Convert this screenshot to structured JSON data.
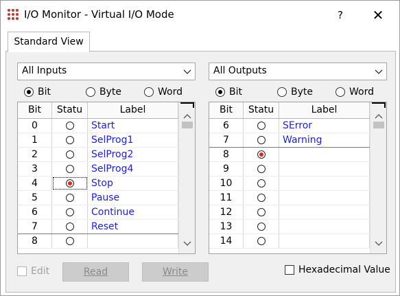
{
  "window": {
    "title": "I/O Monitor - Virtual I/O Mode",
    "help_label": "?",
    "close_label": "✕"
  },
  "tabs": [
    "Standard View"
  ],
  "inputs": {
    "combo_value": "All Inputs",
    "radios": [
      "Bit",
      "Byte",
      "Word"
    ],
    "selected_radio": "Bit",
    "columns": [
      "Bit",
      "Statu",
      "Label"
    ],
    "rows": [
      {
        "bit": "0",
        "on": false,
        "label": "Start"
      },
      {
        "bit": "1",
        "on": false,
        "label": "SelProg1"
      },
      {
        "bit": "2",
        "on": false,
        "label": "SelProg2"
      },
      {
        "bit": "3",
        "on": false,
        "label": "SelProg4"
      },
      {
        "bit": "4",
        "on": true,
        "label": "Stop"
      },
      {
        "bit": "5",
        "on": false,
        "label": "Pause"
      },
      {
        "bit": "6",
        "on": false,
        "label": "Continue"
      },
      {
        "bit": "7",
        "on": false,
        "label": "Reset"
      },
      {
        "bit": "8",
        "on": false,
        "label": ""
      }
    ]
  },
  "outputs": {
    "combo_value": "All Outputs",
    "radios": [
      "Bit",
      "Byte",
      "Word"
    ],
    "selected_radio": "Bit",
    "columns": [
      "Bit",
      "Statu",
      "Label"
    ],
    "rows": [
      {
        "bit": "6",
        "on": false,
        "label": "SError"
      },
      {
        "bit": "7",
        "on": false,
        "label": "Warning"
      },
      {
        "bit": "8",
        "on": true,
        "label": ""
      },
      {
        "bit": "9",
        "on": false,
        "label": ""
      },
      {
        "bit": "10",
        "on": false,
        "label": ""
      },
      {
        "bit": "11",
        "on": false,
        "label": ""
      },
      {
        "bit": "12",
        "on": false,
        "label": ""
      },
      {
        "bit": "13",
        "on": false,
        "label": ""
      },
      {
        "bit": "14",
        "on": false,
        "label": ""
      }
    ]
  },
  "footer": {
    "edit_label": "Edit",
    "read_label": "Read",
    "write_label": "Write",
    "hex_label": "Hexadecimal Value"
  },
  "colors": {
    "label_text": "#1a1aff",
    "led_on": "#e8231c",
    "disabled_button": "#cccccc"
  }
}
